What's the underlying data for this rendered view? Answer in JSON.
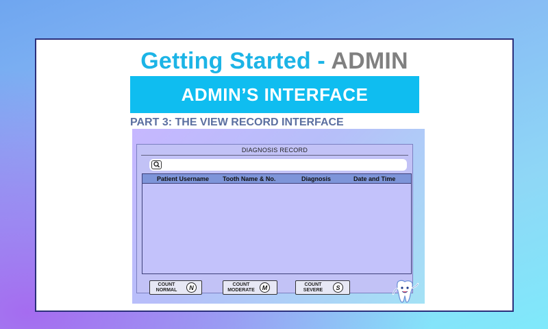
{
  "heading": {
    "part1": "Getting Started - ",
    "part2": "ADMIN"
  },
  "banner": "ADMIN’S INTERFACE",
  "subheading": "PART 3: THE VIEW RECORD INTERFACE",
  "screen": {
    "title": "DIAGNOSIS RECORD",
    "search": {
      "icon": "search-icon",
      "value": ""
    },
    "table": {
      "columns": [
        "Patient Username",
        "Tooth Name & No.",
        "Diagnosis",
        "Date and Time"
      ],
      "rows": []
    },
    "buttons": [
      {
        "line1": "COUNT",
        "line2": "NORMAL",
        "letter": "N"
      },
      {
        "line1": "COUNT",
        "line2": "MODERATE",
        "letter": "M"
      },
      {
        "line1": "COUNT",
        "line2": "SEVERE",
        "letter": "S"
      }
    ],
    "mascot_icon": "tooth-mascot-icon"
  },
  "colors": {
    "heading_blue": "#1cb4e6",
    "heading_gray": "#808080",
    "banner_bg": "#0fbdf0",
    "subheading": "#5b6fa0",
    "table_header": "#7e95d9",
    "panel_bg": "#c2c2f6"
  }
}
